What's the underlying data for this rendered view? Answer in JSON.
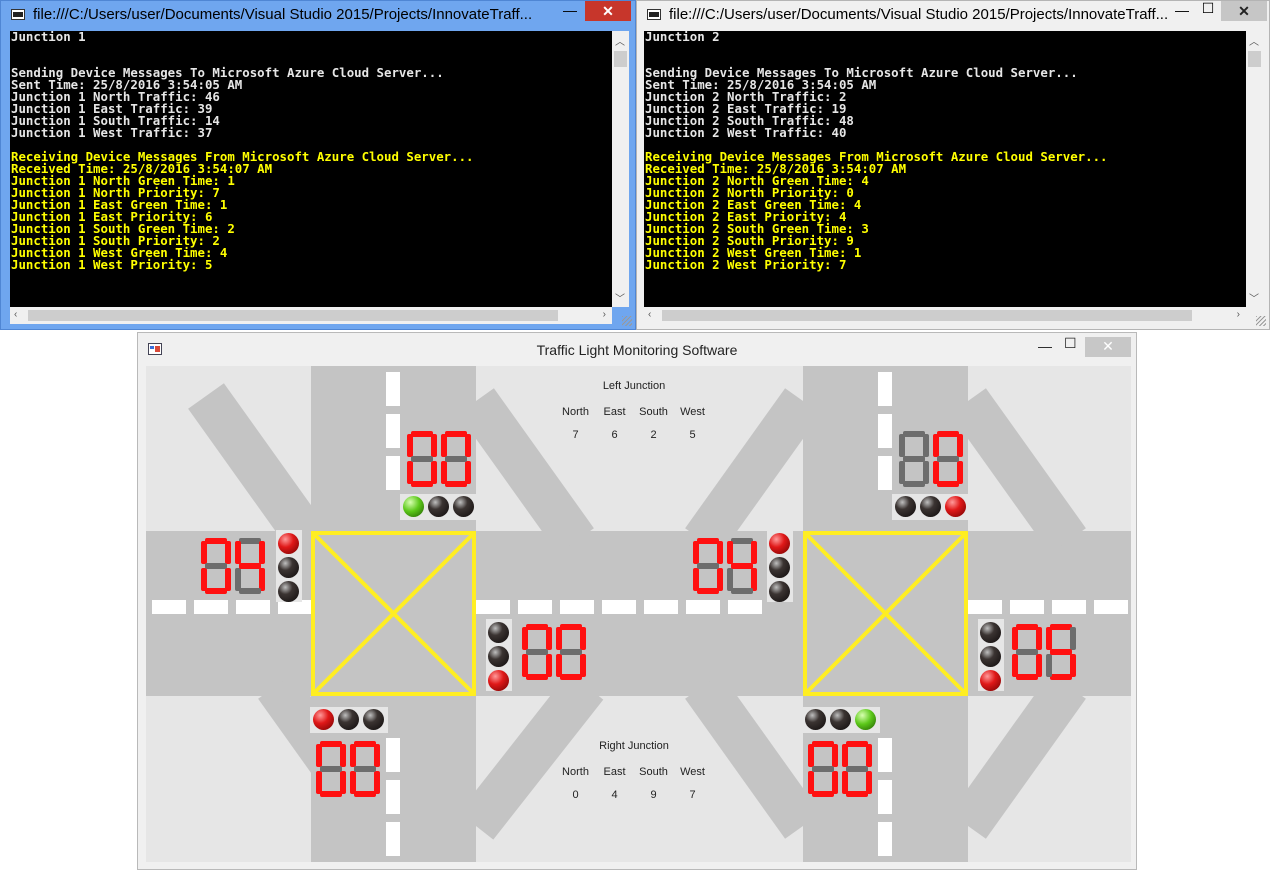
{
  "console1": {
    "title": "file:///C:/Users/user/Documents/Visual Studio 2015/Projects/InnovateTraff...",
    "min": "—",
    "max": "☐",
    "close": "✕",
    "lines": [
      {
        "text": "Junction 1",
        "color": "white"
      },
      {
        "text": "",
        "color": "white"
      },
      {
        "text": "",
        "color": "white"
      },
      {
        "text": "Sending Device Messages To Microsoft Azure Cloud Server...",
        "color": "white"
      },
      {
        "text": "Sent Time: 25/8/2016 3:54:05 AM",
        "color": "white"
      },
      {
        "text": "Junction 1 North Traffic: 46",
        "color": "white"
      },
      {
        "text": "Junction 1 East Traffic: 39",
        "color": "white"
      },
      {
        "text": "Junction 1 South Traffic: 14",
        "color": "white"
      },
      {
        "text": "Junction 1 West Traffic: 37",
        "color": "white"
      },
      {
        "text": "",
        "color": "white"
      },
      {
        "text": "Receiving Device Messages From Microsoft Azure Cloud Server...",
        "color": "yellow"
      },
      {
        "text": "Received Time: 25/8/2016 3:54:07 AM",
        "color": "yellow"
      },
      {
        "text": "Junction 1 North Green Time: 1",
        "color": "yellow"
      },
      {
        "text": "Junction 1 North Priority: 7",
        "color": "yellow"
      },
      {
        "text": "Junction 1 East Green Time: 1",
        "color": "yellow"
      },
      {
        "text": "Junction 1 East Priority: 6",
        "color": "yellow"
      },
      {
        "text": "Junction 1 South Green Time: 2",
        "color": "yellow"
      },
      {
        "text": "Junction 1 South Priority: 2",
        "color": "yellow"
      },
      {
        "text": "Junction 1 West Green Time: 4",
        "color": "yellow"
      },
      {
        "text": "Junction 1 West Priority: 5",
        "color": "yellow"
      }
    ]
  },
  "console2": {
    "title": "file:///C:/Users/user/Documents/Visual Studio 2015/Projects/InnovateTraff...",
    "min": "—",
    "max": "☐",
    "close": "✕",
    "lines": [
      {
        "text": "Junction 2",
        "color": "white"
      },
      {
        "text": "",
        "color": "white"
      },
      {
        "text": "",
        "color": "white"
      },
      {
        "text": "Sending Device Messages To Microsoft Azure Cloud Server...",
        "color": "white"
      },
      {
        "text": "Sent Time: 25/8/2016 3:54:05 AM",
        "color": "white"
      },
      {
        "text": "Junction 2 North Traffic: 2",
        "color": "white"
      },
      {
        "text": "Junction 2 East Traffic: 19",
        "color": "white"
      },
      {
        "text": "Junction 2 South Traffic: 48",
        "color": "white"
      },
      {
        "text": "Junction 2 West Traffic: 40",
        "color": "white"
      },
      {
        "text": "",
        "color": "white"
      },
      {
        "text": "Receiving Device Messages From Microsoft Azure Cloud Server...",
        "color": "yellow"
      },
      {
        "text": "Received Time: 25/8/2016 3:54:07 AM",
        "color": "yellow"
      },
      {
        "text": "Junction 2 North Green Time: 4",
        "color": "yellow"
      },
      {
        "text": "Junction 2 North Priority: 0",
        "color": "yellow"
      },
      {
        "text": "Junction 2 East Green Time: 4",
        "color": "yellow"
      },
      {
        "text": "Junction 2 East Priority: 4",
        "color": "yellow"
      },
      {
        "text": "Junction 2 South Green Time: 3",
        "color": "yellow"
      },
      {
        "text": "Junction 2 South Priority: 9",
        "color": "yellow"
      },
      {
        "text": "Junction 2 West Green Time: 1",
        "color": "yellow"
      },
      {
        "text": "Junction 2 West Priority: 7",
        "color": "yellow"
      }
    ]
  },
  "app": {
    "title": "Traffic Light Monitoring Software",
    "min": "—",
    "max": "☐",
    "close": "✕",
    "directions": [
      "North",
      "East",
      "South",
      "West"
    ],
    "left_panel": {
      "title": "Left Junction",
      "values": [
        "7",
        "6",
        "2",
        "5"
      ]
    },
    "right_panel": {
      "title": "Right Junction",
      "values": [
        "0",
        "4",
        "9",
        "7"
      ]
    },
    "colors": {
      "road": "#c4c4c4",
      "ground": "#e6e6e6",
      "box": "#ffee22",
      "seg_on": "#ff1010",
      "seg_off": "#6d6d6d"
    },
    "displays": [
      {
        "name": "j1-north-display",
        "value": "00",
        "lights": [
          "green",
          "off",
          "off"
        ]
      },
      {
        "name": "j1-west-display",
        "value": "04",
        "lights": [
          "red",
          "off",
          "off"
        ]
      },
      {
        "name": "j1-east-display",
        "value": "00",
        "lights": [
          "off",
          "off",
          "red"
        ]
      },
      {
        "name": "j1-south-display",
        "value": "00",
        "lights": [
          "red",
          "off",
          "off"
        ]
      },
      {
        "name": "j2-north-display",
        "value": "0",
        "lights": [
          "off",
          "off",
          "red"
        ]
      },
      {
        "name": "j2-west-display",
        "value": "04",
        "lights": [
          "red",
          "off",
          "off"
        ]
      },
      {
        "name": "j2-east-display",
        "value": "05",
        "lights": [
          "off",
          "off",
          "red"
        ]
      },
      {
        "name": "j2-south-display",
        "value": "00",
        "lights": [
          "off",
          "off",
          "green"
        ]
      }
    ]
  }
}
